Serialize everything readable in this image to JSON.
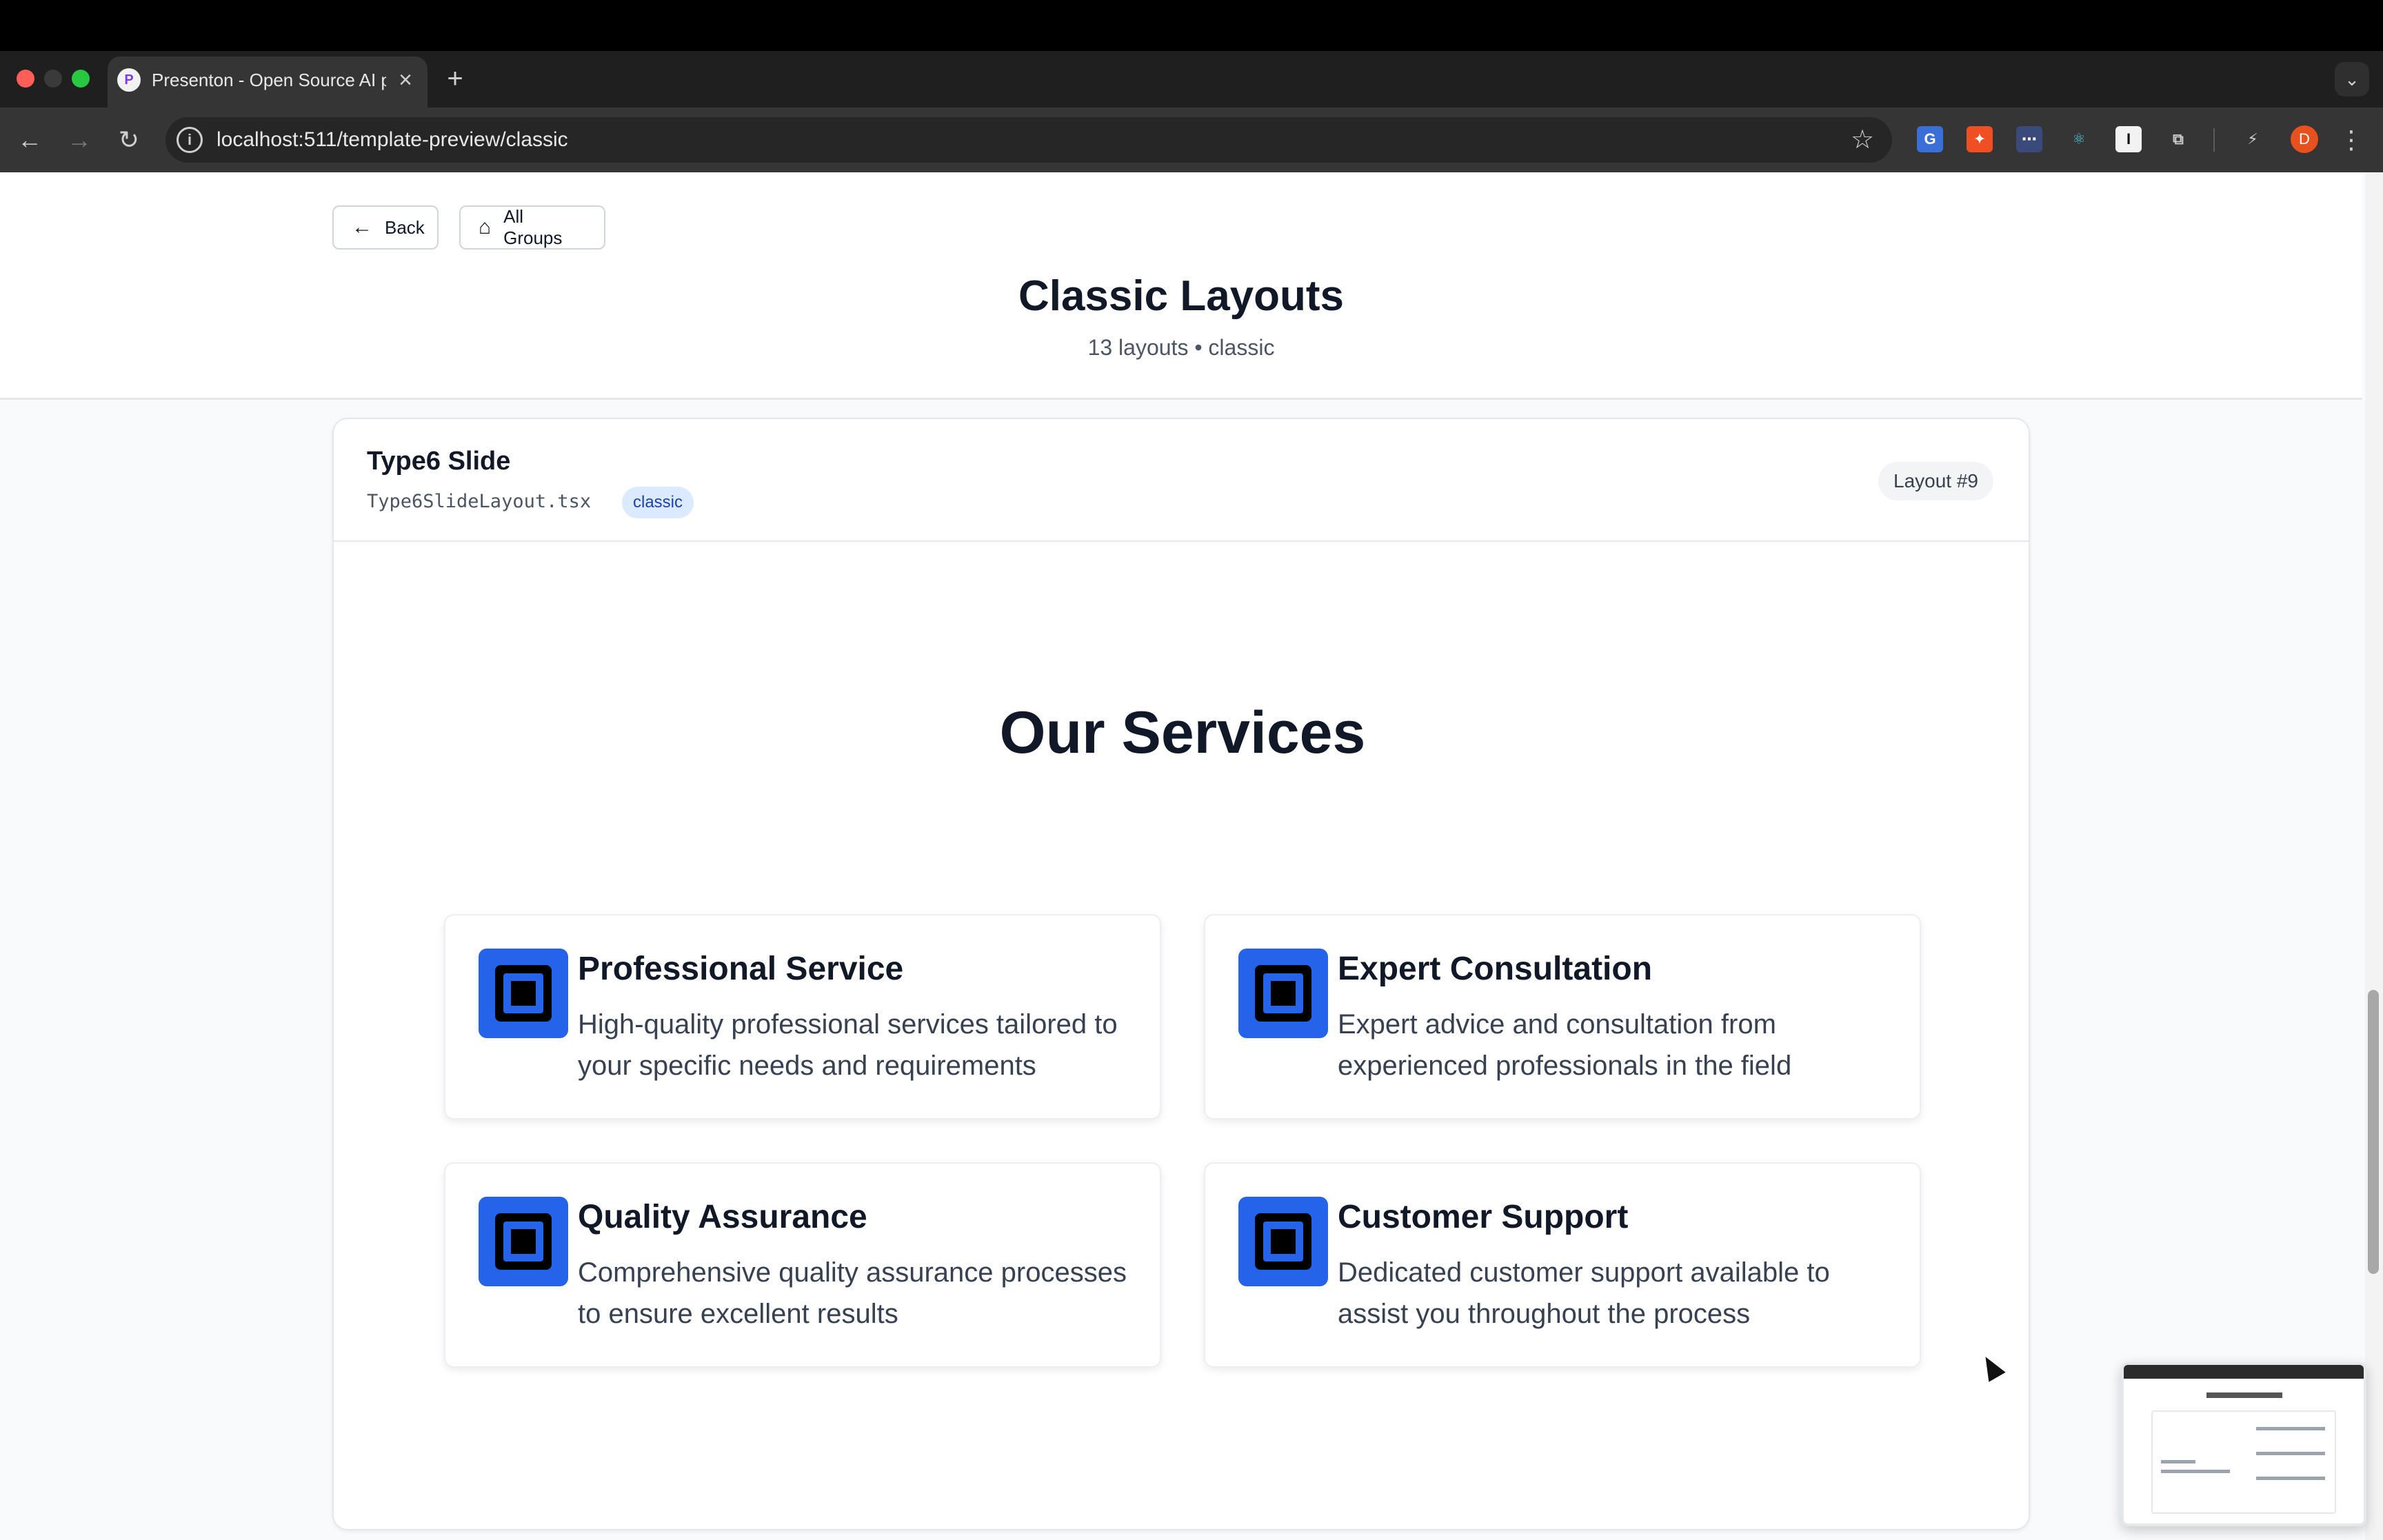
{
  "browser": {
    "tab_title": "Presenton - Open Source AI presentation generator",
    "tab_close": "×",
    "new_tab": "+",
    "url": "localhost:511/template-preview/classic",
    "avatar_initial": "D"
  },
  "page": {
    "back_label": "Back",
    "all_groups_label": "All Groups",
    "title": "Classic Layouts",
    "subtitle": "13 layouts • classic"
  },
  "layout_card": {
    "name": "Type6 Slide",
    "file": "Type6SlideLayout.tsx",
    "tag": "classic",
    "badge": "Layout #9"
  },
  "slide": {
    "title": "Our Services",
    "services": [
      {
        "title": "Professional Service",
        "description": "High-quality professional services tailored to your specific needs and requirements"
      },
      {
        "title": "Expert Consultation",
        "description": "Expert advice and consultation from experienced professionals in the field"
      },
      {
        "title": "Quality Assurance",
        "description": "Comprehensive quality assurance processes to ensure excellent results"
      },
      {
        "title": "Customer Support",
        "description": "Dedicated customer support available to assist you throughout the process"
      }
    ]
  },
  "icons": {
    "back": "arrow-left-icon",
    "all_groups": "home-icon",
    "service": "square-frame-icon"
  },
  "colors": {
    "accent": "#2563eb",
    "tag_bg": "#dbeafe",
    "tag_text": "#1e40af"
  }
}
